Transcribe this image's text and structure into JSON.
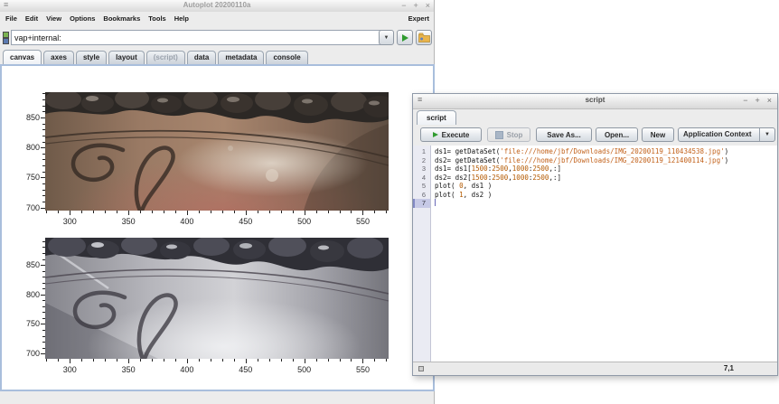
{
  "main_window": {
    "title": "Autoplot 20200110a",
    "window_controls": {
      "menu": "≡",
      "minimize": "−",
      "maximize": "+",
      "close": "×"
    },
    "menu_items": [
      "File",
      "Edit",
      "View",
      "Options",
      "Bookmarks",
      "Tools",
      "Help"
    ],
    "expert_label": "Expert",
    "address_bar": {
      "value": "vap+internal:",
      "dropdown_glyph": "▼"
    },
    "tabs": [
      "canvas",
      "axes",
      "style",
      "layout",
      "(script)",
      "data",
      "metadata",
      "console"
    ],
    "selected_tab": "canvas"
  },
  "chart_data": [
    {
      "type": "image",
      "description": "Top plot: cropped photo of engraved silver plate, warm bronze tones, floral relief rim and cursive monogram",
      "x_ticks": [
        300,
        350,
        400,
        450,
        500,
        550
      ],
      "y_ticks": [
        700,
        750,
        800,
        850
      ],
      "xlim": [
        279,
        572
      ],
      "ylim": [
        695,
        892
      ],
      "minor_tick_step": 10
    },
    {
      "type": "image",
      "description": "Bottom plot: second cropped photo of the same engraved plate, bright silver-gray tones",
      "x_ticks": [
        300,
        350,
        400,
        450,
        500,
        550
      ],
      "y_ticks": [
        700,
        750,
        800,
        850
      ],
      "xlim": [
        279,
        572
      ],
      "ylim": [
        691,
        896
      ],
      "minor_tick_step": 10
    }
  ],
  "script_window": {
    "title": "script",
    "window_controls": {
      "menu": "≡",
      "minimize": "−",
      "maximize": "+",
      "close": "×"
    },
    "tab": "script",
    "toolbar": {
      "execute": "Execute",
      "stop": "Stop",
      "save_as": "Save As...",
      "open": "Open...",
      "new_label": "New",
      "context": "Application Context",
      "context_dropdown_glyph": "▼"
    },
    "editor": {
      "cursor_line": 7,
      "lines": [
        {
          "num": 1,
          "segments": [
            [
              "ds1= getDataSet(",
              "k"
            ],
            [
              "'file:///home/jbf/Downloads/IMG_20200119_110434538.jpg'",
              "s"
            ],
            [
              ")",
              "k"
            ]
          ]
        },
        {
          "num": 2,
          "segments": [
            [
              "ds2= getDataSet(",
              "k"
            ],
            [
              "'file:///home/jbf/Downloads/IMG_20200119_121400114.jpg'",
              "s"
            ],
            [
              ")",
              "k"
            ]
          ]
        },
        {
          "num": 3,
          "segments": [
            [
              "ds1= ds1[",
              "k"
            ],
            [
              "1500",
              "n"
            ],
            [
              ":",
              "k"
            ],
            [
              "2500",
              "n"
            ],
            [
              ",",
              "k"
            ],
            [
              "1000",
              "n"
            ],
            [
              ":",
              "k"
            ],
            [
              "2500",
              "n"
            ],
            [
              ",:]",
              "k"
            ]
          ]
        },
        {
          "num": 4,
          "segments": [
            [
              "ds2= ds2[",
              "k"
            ],
            [
              "1500",
              "n"
            ],
            [
              ":",
              "k"
            ],
            [
              "2500",
              "n"
            ],
            [
              ",",
              "k"
            ],
            [
              "1000",
              "n"
            ],
            [
              ":",
              "k"
            ],
            [
              "2500",
              "n"
            ],
            [
              ",:]",
              "k"
            ]
          ]
        },
        {
          "num": 5,
          "segments": [
            [
              "plot( ",
              "k"
            ],
            [
              "0",
              "n"
            ],
            [
              ", ds1 )",
              "k"
            ]
          ]
        },
        {
          "num": 6,
          "segments": [
            [
              "plot( ",
              "k"
            ],
            [
              "1",
              "n"
            ],
            [
              ", ds2 )",
              "k"
            ]
          ]
        },
        {
          "num": 7,
          "segments": []
        }
      ]
    },
    "status": {
      "caret_position": "7,1"
    }
  }
}
